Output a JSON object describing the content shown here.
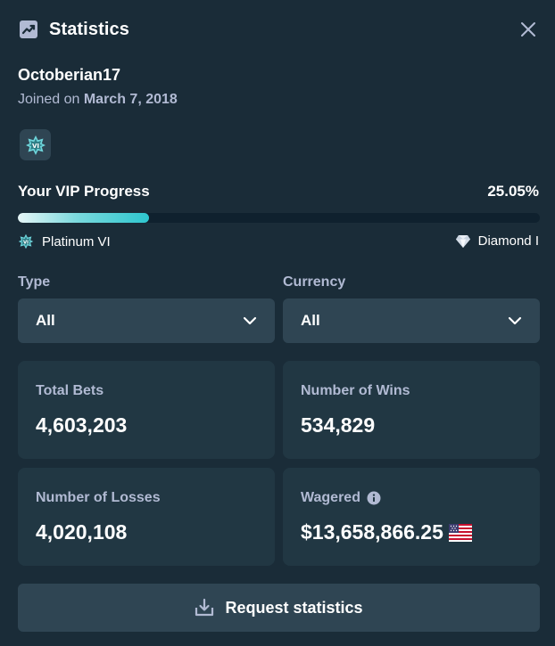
{
  "header": {
    "title": "Statistics",
    "title_icon": "line-chart-icon",
    "close_icon": "close-icon"
  },
  "user": {
    "username": "Octoberian17",
    "joined_prefix": "Joined on",
    "joined_date": "March 7, 2018",
    "vip_badge_icon": "vip-star-badge-icon"
  },
  "progress": {
    "label": "Your VIP Progress",
    "value_text": "25.05%",
    "fraction": 0.2505,
    "current_rank": "Platinum VI",
    "next_rank": "Diamond I",
    "current_rank_icon": "platinum-star-icon",
    "next_rank_icon": "diamond-icon"
  },
  "filters": {
    "type_label": "Type",
    "type_value": "All",
    "currency_label": "Currency",
    "currency_value": "All"
  },
  "stats": {
    "total_bets_label": "Total Bets",
    "total_bets_value": "4,603,203",
    "wins_label": "Number of Wins",
    "wins_value": "534,829",
    "losses_label": "Number of Losses",
    "losses_value": "4,020,108",
    "wagered_label": "Wagered",
    "wagered_value": "$13,658,866.25",
    "wagered_currency_icon": "us-flag-icon"
  },
  "actions": {
    "request_label": "Request statistics",
    "request_icon": "download-icon"
  },
  "colors": {
    "background": "#1a2c38",
    "card": "#213743",
    "control": "#2f4553",
    "muted_text": "#b1bad3",
    "progress_accent": "#2ec7cf"
  }
}
